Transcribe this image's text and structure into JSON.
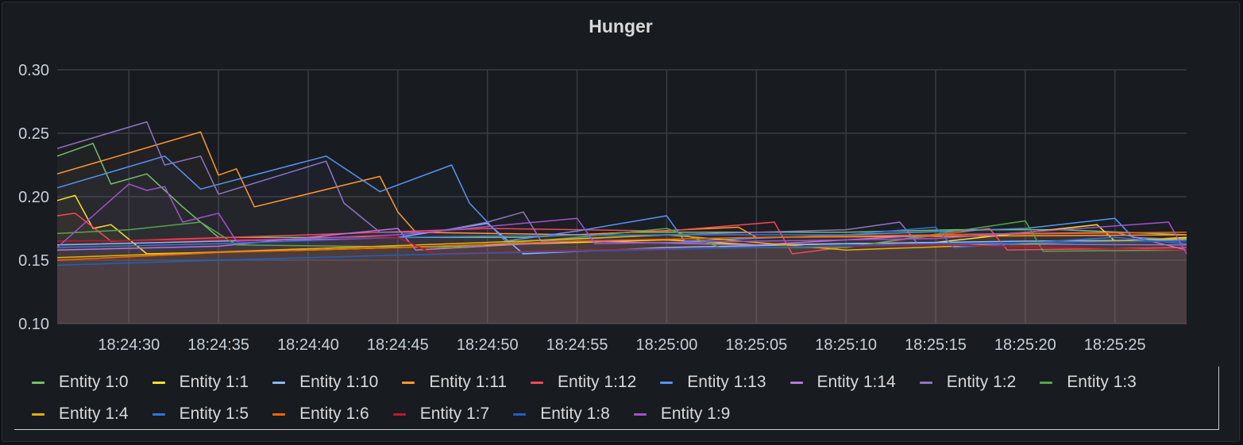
{
  "panel": {
    "title": "Hunger"
  },
  "chart_data": {
    "type": "line",
    "title": "Hunger",
    "xlabel": "",
    "ylabel": "",
    "ylim": [
      0.1,
      0.3
    ],
    "yticks": [
      "0.10",
      "0.15",
      "0.20",
      "0.25",
      "0.30"
    ],
    "xlim": [
      "18:24:26",
      "18:25:29"
    ],
    "xticks": [
      "18:24:30",
      "18:24:35",
      "18:24:40",
      "18:24:45",
      "18:24:50",
      "18:24:55",
      "18:25:00",
      "18:25:05",
      "18:25:10",
      "18:25:15",
      "18:25:20",
      "18:25:25"
    ],
    "grid": true,
    "legend_position": "bottom",
    "series": [
      {
        "name": "Entity 1:0",
        "color": "#73bf69",
        "points": [
          [
            "18:24:26",
            0.232
          ],
          [
            "18:24:28",
            0.242
          ],
          [
            "18:24:29",
            0.21
          ],
          [
            "18:24:31",
            0.218
          ],
          [
            "18:24:33",
            0.192
          ],
          [
            "18:24:35",
            0.168
          ],
          [
            "18:24:40",
            0.168
          ],
          [
            "18:24:46",
            0.168
          ],
          [
            "18:24:52",
            0.168
          ],
          [
            "18:24:58",
            0.172
          ],
          [
            "18:25:04",
            0.172
          ],
          [
            "18:25:10",
            0.172
          ],
          [
            "18:25:16",
            0.174
          ],
          [
            "18:25:22",
            0.174
          ],
          [
            "18:25:29",
            0.17
          ]
        ]
      },
      {
        "name": "Entity 1:1",
        "color": "#fade2a",
        "points": [
          [
            "18:24:26",
            0.197
          ],
          [
            "18:24:27",
            0.201
          ],
          [
            "18:24:28",
            0.175
          ],
          [
            "18:24:29",
            0.178
          ],
          [
            "18:24:31",
            0.155
          ],
          [
            "18:24:40",
            0.158
          ],
          [
            "18:24:50",
            0.162
          ],
          [
            "18:25:00",
            0.166
          ],
          [
            "18:25:05",
            0.162
          ],
          [
            "18:25:15",
            0.164
          ],
          [
            "18:25:24",
            0.178
          ],
          [
            "18:25:25",
            0.165
          ],
          [
            "18:25:29",
            0.168
          ]
        ]
      },
      {
        "name": "Entity 1:10",
        "color": "#8ab8ff",
        "points": [
          [
            "18:24:26",
            0.162
          ],
          [
            "18:24:35",
            0.165
          ],
          [
            "18:24:45",
            0.168
          ],
          [
            "18:24:50",
            0.179
          ],
          [
            "18:24:52",
            0.155
          ],
          [
            "18:25:00",
            0.16
          ],
          [
            "18:25:10",
            0.163
          ],
          [
            "18:25:20",
            0.165
          ],
          [
            "18:25:29",
            0.166
          ]
        ]
      },
      {
        "name": "Entity 1:11",
        "color": "#ff9830",
        "points": [
          [
            "18:24:26",
            0.218
          ],
          [
            "18:24:34",
            0.251
          ],
          [
            "18:24:35",
            0.217
          ],
          [
            "18:24:36",
            0.222
          ],
          [
            "18:24:37",
            0.192
          ],
          [
            "18:24:44",
            0.216
          ],
          [
            "18:24:45",
            0.188
          ],
          [
            "18:24:46",
            0.172
          ],
          [
            "18:24:55",
            0.17
          ],
          [
            "18:25:04",
            0.176
          ],
          [
            "18:25:05",
            0.168
          ],
          [
            "18:25:29",
            0.17
          ]
        ]
      },
      {
        "name": "Entity 1:12",
        "color": "#f2495c",
        "points": [
          [
            "18:24:26",
            0.185
          ],
          [
            "18:24:27",
            0.187
          ],
          [
            "18:24:29",
            0.165
          ],
          [
            "18:24:40",
            0.17
          ],
          [
            "18:24:50",
            0.175
          ],
          [
            "18:25:00",
            0.173
          ],
          [
            "18:25:06",
            0.18
          ],
          [
            "18:25:07",
            0.155
          ],
          [
            "18:25:18",
            0.175
          ],
          [
            "18:25:19",
            0.158
          ],
          [
            "18:25:29",
            0.16
          ]
        ]
      },
      {
        "name": "Entity 1:13",
        "color": "#5794f2",
        "points": [
          [
            "18:24:26",
            0.207
          ],
          [
            "18:24:32",
            0.232
          ],
          [
            "18:24:34",
            0.206
          ],
          [
            "18:24:41",
            0.232
          ],
          [
            "18:24:44",
            0.204
          ],
          [
            "18:24:48",
            0.225
          ],
          [
            "18:24:49",
            0.195
          ],
          [
            "18:24:51",
            0.165
          ],
          [
            "18:24:55",
            0.173
          ],
          [
            "18:25:00",
            0.185
          ],
          [
            "18:25:01",
            0.165
          ],
          [
            "18:25:10",
            0.17
          ],
          [
            "18:25:20",
            0.175
          ],
          [
            "18:25:25",
            0.183
          ],
          [
            "18:25:26",
            0.168
          ],
          [
            "18:25:29",
            0.166
          ]
        ]
      },
      {
        "name": "Entity 1:14",
        "color": "#b877d9",
        "points": [
          [
            "18:24:26",
            0.158
          ],
          [
            "18:24:35",
            0.161
          ],
          [
            "18:24:45",
            0.175
          ],
          [
            "18:24:46",
            0.158
          ],
          [
            "18:24:55",
            0.165
          ],
          [
            "18:25:05",
            0.162
          ],
          [
            "18:25:15",
            0.17
          ],
          [
            "18:25:25",
            0.172
          ],
          [
            "18:25:29",
            0.158
          ]
        ]
      },
      {
        "name": "Entity 1:2",
        "color": "#8f75c2",
        "points": [
          [
            "18:24:26",
            0.238
          ],
          [
            "18:24:31",
            0.259
          ],
          [
            "18:24:32",
            0.225
          ],
          [
            "18:24:34",
            0.232
          ],
          [
            "18:24:35",
            0.202
          ],
          [
            "18:24:41",
            0.228
          ],
          [
            "18:24:42",
            0.195
          ],
          [
            "18:24:44",
            0.172
          ],
          [
            "18:24:47",
            0.172
          ],
          [
            "18:24:50",
            0.18
          ],
          [
            "18:24:52",
            0.188
          ],
          [
            "18:24:53",
            0.165
          ],
          [
            "18:25:00",
            0.17
          ],
          [
            "18:25:10",
            0.174
          ],
          [
            "18:25:13",
            0.18
          ],
          [
            "18:25:14",
            0.163
          ],
          [
            "18:25:29",
            0.162
          ]
        ]
      },
      {
        "name": "Entity 1:3",
        "color": "#56a64b",
        "points": [
          [
            "18:24:26",
            0.171
          ],
          [
            "18:24:30",
            0.174
          ],
          [
            "18:24:34",
            0.18
          ],
          [
            "18:24:36",
            0.162
          ],
          [
            "18:24:48",
            0.16
          ],
          [
            "18:24:55",
            0.168
          ],
          [
            "18:25:00",
            0.175
          ],
          [
            "18:25:03",
            0.16
          ],
          [
            "18:25:10",
            0.16
          ],
          [
            "18:25:20",
            0.181
          ],
          [
            "18:25:21",
            0.157
          ],
          [
            "18:25:29",
            0.158
          ]
        ]
      },
      {
        "name": "Entity 1:4",
        "color": "#e0b400",
        "points": [
          [
            "18:24:26",
            0.152
          ],
          [
            "18:24:40",
            0.159
          ],
          [
            "18:24:50",
            0.164
          ],
          [
            "18:25:00",
            0.17
          ],
          [
            "18:25:10",
            0.158
          ],
          [
            "18:25:20",
            0.163
          ],
          [
            "18:25:29",
            0.167
          ]
        ]
      },
      {
        "name": "Entity 1:5",
        "color": "#3274d9",
        "points": [
          [
            "18:24:26",
            0.16
          ],
          [
            "18:24:35",
            0.163
          ],
          [
            "18:24:45",
            0.168
          ],
          [
            "18:24:50",
            0.169
          ],
          [
            "18:25:00",
            0.17
          ],
          [
            "18:25:10",
            0.17
          ],
          [
            "18:25:15",
            0.176
          ],
          [
            "18:25:16",
            0.16
          ],
          [
            "18:25:25",
            0.168
          ],
          [
            "18:25:29",
            0.163
          ]
        ]
      },
      {
        "name": "Entity 1:6",
        "color": "#fa6400",
        "points": [
          [
            "18:24:26",
            0.15
          ],
          [
            "18:24:35",
            0.156
          ],
          [
            "18:24:45",
            0.16
          ],
          [
            "18:24:55",
            0.165
          ],
          [
            "18:25:05",
            0.168
          ],
          [
            "18:25:15",
            0.17
          ],
          [
            "18:25:29",
            0.172
          ]
        ]
      },
      {
        "name": "Entity 1:7",
        "color": "#c4162a",
        "points": [
          [
            "18:24:26",
            0.165
          ],
          [
            "18:24:35",
            0.166
          ],
          [
            "18:24:45",
            0.168
          ],
          [
            "18:24:47",
            0.155
          ],
          [
            "18:24:55",
            0.158
          ],
          [
            "18:25:05",
            0.16
          ],
          [
            "18:25:15",
            0.162
          ],
          [
            "18:25:29",
            0.158
          ]
        ]
      },
      {
        "name": "Entity 1:8",
        "color": "#1f60c4",
        "points": [
          [
            "18:24:26",
            0.146
          ],
          [
            "18:24:35",
            0.15
          ],
          [
            "18:24:45",
            0.154
          ],
          [
            "18:24:55",
            0.157
          ],
          [
            "18:25:05",
            0.16
          ],
          [
            "18:25:15",
            0.163
          ],
          [
            "18:25:29",
            0.165
          ]
        ]
      },
      {
        "name": "Entity 1:9",
        "color": "#a352cc",
        "points": [
          [
            "18:24:26",
            0.16
          ],
          [
            "18:24:30",
            0.21
          ],
          [
            "18:24:31",
            0.205
          ],
          [
            "18:24:32",
            0.208
          ],
          [
            "18:24:33",
            0.18
          ],
          [
            "18:24:35",
            0.187
          ],
          [
            "18:24:36",
            0.165
          ],
          [
            "18:24:45",
            0.17
          ],
          [
            "18:24:55",
            0.183
          ],
          [
            "18:24:56",
            0.163
          ],
          [
            "18:25:05",
            0.165
          ],
          [
            "18:25:15",
            0.167
          ],
          [
            "18:25:28",
            0.18
          ],
          [
            "18:25:29",
            0.155
          ]
        ]
      }
    ]
  }
}
